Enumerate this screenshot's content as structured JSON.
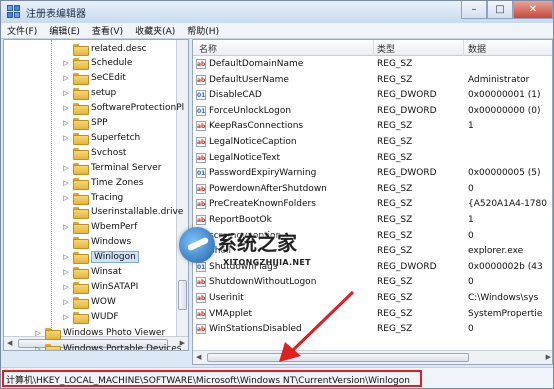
{
  "window": {
    "title": "注册表编辑器",
    "controls": [
      "–",
      "□",
      "✕"
    ]
  },
  "menu": [
    "文件(F)",
    "编辑(E)",
    "查看(V)",
    "收藏夹(A)",
    "帮助(H)"
  ],
  "tree": {
    "items": [
      {
        "label": "related.desc",
        "expander": ""
      },
      {
        "label": "Schedule",
        "expander": "▷"
      },
      {
        "label": "SeCEdit",
        "expander": "▷"
      },
      {
        "label": "setup",
        "expander": "▷"
      },
      {
        "label": "SoftwareProtectionPl",
        "expander": "▷"
      },
      {
        "label": "SPP",
        "expander": "▷"
      },
      {
        "label": "Superfetch",
        "expander": "▷"
      },
      {
        "label": "Svchost",
        "expander": ""
      },
      {
        "label": "Terminal Server",
        "expander": "▷"
      },
      {
        "label": "Time Zones",
        "expander": "▷"
      },
      {
        "label": "Tracing",
        "expander": "▷"
      },
      {
        "label": "Userinstallable.drive",
        "expander": ""
      },
      {
        "label": "WbemPerf",
        "expander": "▷"
      },
      {
        "label": "Windows",
        "expander": ""
      },
      {
        "label": "Winlogon",
        "expander": "▷",
        "selected": true
      },
      {
        "label": "Winsat",
        "expander": "▷"
      },
      {
        "label": "WinSATAPI",
        "expander": "▷"
      },
      {
        "label": "WOW",
        "expander": "▷"
      },
      {
        "label": "WUDF",
        "expander": "▷"
      }
    ],
    "root_items": [
      {
        "label": "Windows Photo Viewer",
        "expander": "▷"
      },
      {
        "label": "Windows Portable Devices",
        "expander": "▷"
      }
    ]
  },
  "list": {
    "headers": [
      "名称",
      "类型",
      "数据"
    ],
    "rows": [
      {
        "name": "DefaultDomainName",
        "type": "REG_SZ",
        "data": "",
        "icon": "ab"
      },
      {
        "name": "DefaultUserName",
        "type": "REG_SZ",
        "data": "Administrator",
        "icon": "ab"
      },
      {
        "name": "DisableCAD",
        "type": "REG_DWORD",
        "data": "0x00000001 (1)",
        "icon": "dword"
      },
      {
        "name": "ForceUnlockLogon",
        "type": "REG_DWORD",
        "data": "0x00000000 (0)",
        "icon": "dword"
      },
      {
        "name": "KeepRasConnections",
        "type": "REG_SZ",
        "data": "1",
        "icon": "ab"
      },
      {
        "name": "LegalNoticeCaption",
        "type": "REG_SZ",
        "data": "",
        "icon": "ab"
      },
      {
        "name": "LegalNoticeText",
        "type": "REG_SZ",
        "data": "",
        "icon": "ab"
      },
      {
        "name": "PasswordExpiryWarning",
        "type": "REG_DWORD",
        "data": "0x00000005 (5)",
        "icon": "dword"
      },
      {
        "name": "PowerdownAfterShutdown",
        "type": "REG_SZ",
        "data": "0",
        "icon": "ab"
      },
      {
        "name": "PreCreateKnownFolders",
        "type": "REG_SZ",
        "data": "{A520A1A4-1780",
        "icon": "ab"
      },
      {
        "name": "ReportBootOk",
        "type": "REG_SZ",
        "data": "1",
        "icon": "ab"
      },
      {
        "name": "scremoveoption",
        "type": "REG_SZ",
        "data": "0",
        "icon": "ab"
      },
      {
        "name": "Shell",
        "type": "REG_SZ",
        "data": "explorer.exe",
        "icon": "ab"
      },
      {
        "name": "ShutdownFlags",
        "type": "REG_DWORD",
        "data": "0x0000002b (43",
        "icon": "dword"
      },
      {
        "name": "ShutdownWithoutLogon",
        "type": "REG_SZ",
        "data": "0",
        "icon": "ab"
      },
      {
        "name": "Userinit",
        "type": "REG_SZ",
        "data": "C:\\Windows\\sys",
        "icon": "ab"
      },
      {
        "name": "VMApplet",
        "type": "REG_SZ",
        "data": "SystemPropertie",
        "icon": "ab"
      },
      {
        "name": "WinStationsDisabled",
        "type": "REG_SZ",
        "data": "0",
        "icon": "ab"
      }
    ]
  },
  "statusbar": {
    "path": "计算机\\HKEY_LOCAL_MACHINE\\SOFTWARE\\Microsoft\\Windows NT\\CurrentVersion\\Winlogon"
  },
  "watermark": {
    "title": "系统之家",
    "url": "XITONGZHIJIA.NET"
  },
  "colors": {
    "annotation_red": "#e02020",
    "selection": "#cde3f8"
  }
}
